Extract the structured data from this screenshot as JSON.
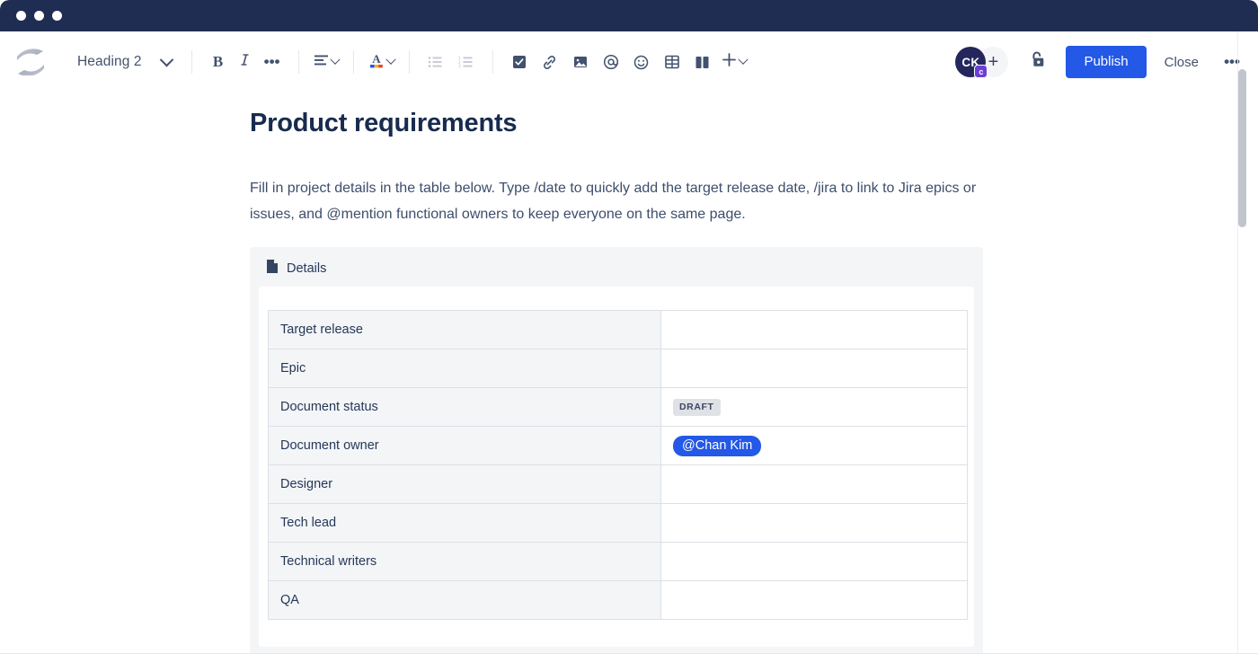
{
  "window": {
    "dots": [
      "red-dot",
      "yellow-dot",
      "green-dot"
    ],
    "titlebar_color": "#1f2d52"
  },
  "toolbar": {
    "logo_name": "confluence-logo",
    "block_type": "Heading 2",
    "bold_label": "B",
    "italic_label": "I",
    "more_formatting_label": "•••",
    "text_color_label": "A",
    "buttons": [
      {
        "name": "bold-button",
        "label": "B"
      },
      {
        "name": "italic-button",
        "label": "I"
      },
      {
        "name": "more-formatting-button",
        "label": "•••"
      },
      {
        "name": "text-align-button",
        "label": "align"
      },
      {
        "name": "text-color-button",
        "label": "A"
      },
      {
        "name": "bullet-list-button",
        "label": "bullet list"
      },
      {
        "name": "numbered-list-button",
        "label": "numbered list"
      },
      {
        "name": "task-list-button",
        "label": "task list"
      },
      {
        "name": "link-button",
        "label": "link"
      },
      {
        "name": "image-button",
        "label": "image"
      },
      {
        "name": "mention-button",
        "label": "mention"
      },
      {
        "name": "emoji-button",
        "label": "emoji"
      },
      {
        "name": "table-button",
        "label": "table"
      },
      {
        "name": "layout-button",
        "label": "layout"
      },
      {
        "name": "insert-button",
        "label": "insert"
      }
    ],
    "avatar_initials": "CK",
    "avatar_badge": "c",
    "add-person_label": "+",
    "restrictions_label": "unlock",
    "publish_label": "Publish",
    "close_label": "Close",
    "more_label": "•••",
    "accent_color": "#2458e6"
  },
  "document": {
    "title": "Product requirements",
    "intro": "Fill in project details in the table below. Type /date to quickly add the target release date, /jira to link to Jira epics or issues, and @mention functional owners to keep everyone on the same page.",
    "panel": {
      "icon": "page-icon",
      "title": "Details",
      "rows": [
        {
          "label": "Target release",
          "value": "",
          "value_type": "empty"
        },
        {
          "label": "Epic",
          "value": "",
          "value_type": "empty"
        },
        {
          "label": "Document status",
          "value": "DRAFT",
          "value_type": "badge"
        },
        {
          "label": "Document owner",
          "value": "@Chan Kim",
          "value_type": "mention"
        },
        {
          "label": "Designer",
          "value": "",
          "value_type": "empty"
        },
        {
          "label": "Tech lead",
          "value": "",
          "value_type": "empty"
        },
        {
          "label": "Technical writers",
          "value": "",
          "value_type": "empty"
        },
        {
          "label": "QA",
          "value": "",
          "value_type": "empty"
        }
      ]
    }
  }
}
